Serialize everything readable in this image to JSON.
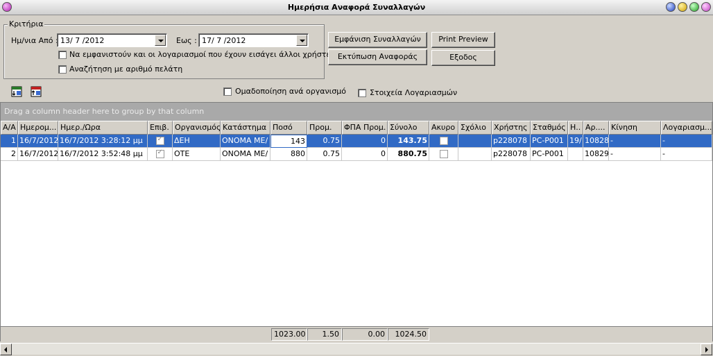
{
  "window": {
    "title": "Ημερήσια Αναφορά Συναλλαγών"
  },
  "criteria": {
    "legend": "Κριτήρια",
    "date_from_label": "Ημ/νια Από :",
    "date_from_value": "13/ 7 /2012",
    "date_to_label": "Εως :",
    "date_to_value": "17/ 7 /2012",
    "show_other_users_label": "Να εμφανιστούν και οι λογαριασμοί που έχουν εισάγει άλλοι χρήστες",
    "show_other_users_checked": false,
    "search_by_customer_label": "Αναζήτηση με αριθμό πελάτη",
    "search_by_customer_checked": false
  },
  "buttons": {
    "show_transactions": "Εμφάνιση Συναλλαγών",
    "print_preview": "Print Preview",
    "print_report": "Εκτύπωση Αναφοράς",
    "exit": "Εξοδος"
  },
  "options": {
    "group_by_org_label": "Ομαδοποίηση ανά οργανισμό",
    "group_by_org_checked": false,
    "account_details_label": "Στοιχεία Λογαριασμών",
    "account_details_checked": false
  },
  "toolbar": {
    "icons": [
      "export-icon",
      "import-icon"
    ]
  },
  "grid": {
    "group_panel_text": "Drag a column header here to group by that column",
    "columns": [
      "Α/Α",
      "Ημερομ...",
      "Ημερ./Ωρα",
      "Επιβ.",
      "Οργανισμός",
      "Κατάστημα",
      "Ποσό",
      "Προμ.",
      "ΦΠΑ Προμ.",
      "Σύνολο",
      "Ακυρο",
      "Σχόλιο",
      "Χρήστης",
      "Σταθμός",
      "Η..",
      "Αρ....",
      "Κίνηση",
      "Λογαριασμ..."
    ],
    "rows": [
      [
        "1",
        "16/7/2012",
        "16/7/2012 3:28:12 μμ",
        "",
        "ΔΕΗ",
        "ΟΝΟΜΑ ΜΕ/",
        "143",
        "0.75",
        "0",
        "143.75",
        "",
        "",
        "p228078",
        "PC-P001",
        "19/",
        "10828",
        "-",
        "-"
      ],
      [
        "2",
        "16/7/2012",
        "16/7/2012 3:52:48 μμ",
        "",
        "OTE",
        "ΟΝΟΜΑ ΜΕ/",
        "880",
        "0.75",
        "0",
        "880.75",
        "",
        "",
        "p228078",
        "PC-P001",
        "",
        "10829",
        "-",
        "-"
      ]
    ],
    "verified": [
      true,
      true
    ],
    "cancelled": [
      false,
      false
    ],
    "totals": {
      "amount": "1023.00",
      "commission": "1.50",
      "vat": "0.00",
      "total": "1024.50"
    }
  },
  "colors": {
    "selection": "#316ac5",
    "group_panel": "#a9a9a9",
    "window_bg": "#d4d0c8"
  }
}
